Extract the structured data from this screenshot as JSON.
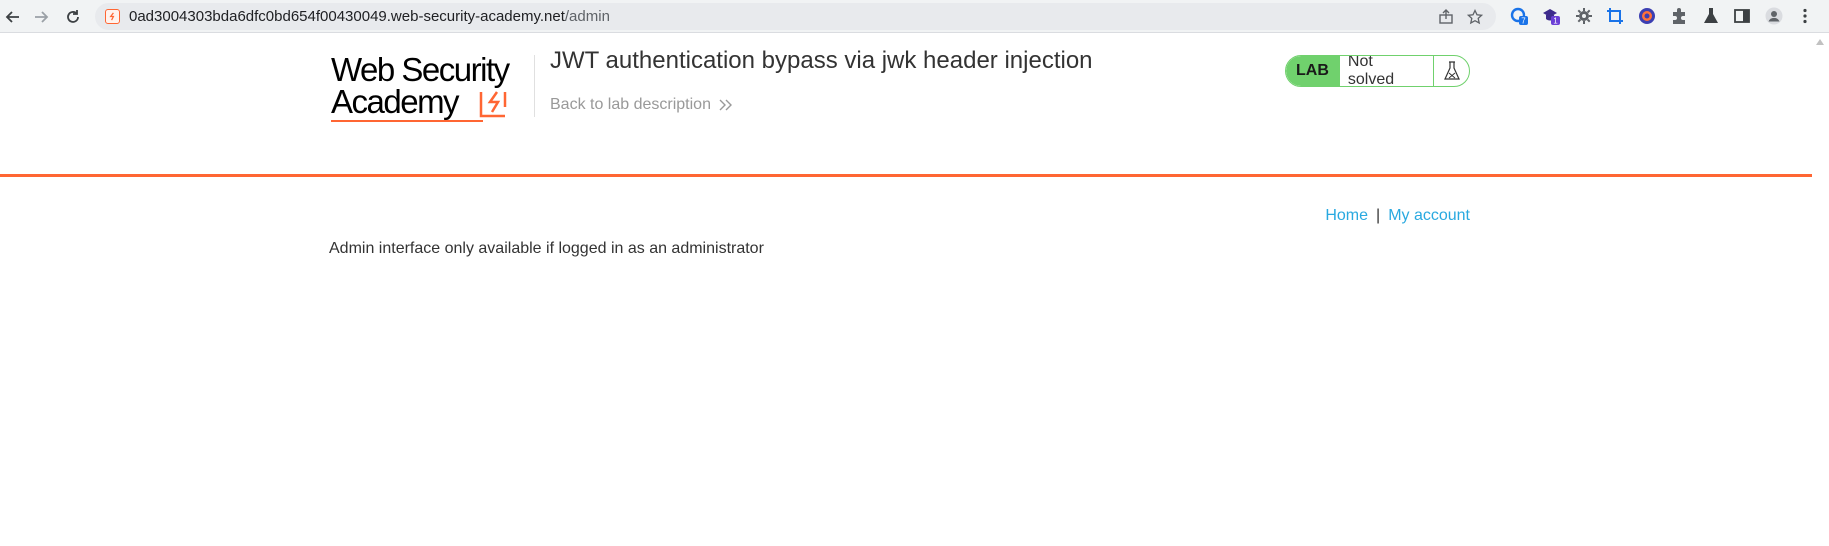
{
  "browser": {
    "url_host": "0ad3004303bda6dfc0bd654f00430049.web-security-academy.net",
    "url_path": "/admin",
    "nav_icons": [
      "back-arrow-icon",
      "forward-arrow-icon",
      "reload-icon"
    ],
    "extension_badges": {
      "ext1": "7",
      "ext2": "1"
    }
  },
  "header": {
    "logo_line1": "Web Security",
    "logo_line2": "Academy",
    "lab_title": "JWT authentication bypass via jwk header injection",
    "back_link": "Back to lab description",
    "lab_badge": "LAB",
    "lab_status": "Not solved"
  },
  "nav": {
    "home": "Home",
    "separator": "|",
    "my_account": "My account"
  },
  "main": {
    "message": "Admin interface only available if logged in as an administrator"
  },
  "colors": {
    "accent_orange": "#ff6633",
    "lab_green": "#70d16d",
    "link_blue": "#29a9e0"
  }
}
